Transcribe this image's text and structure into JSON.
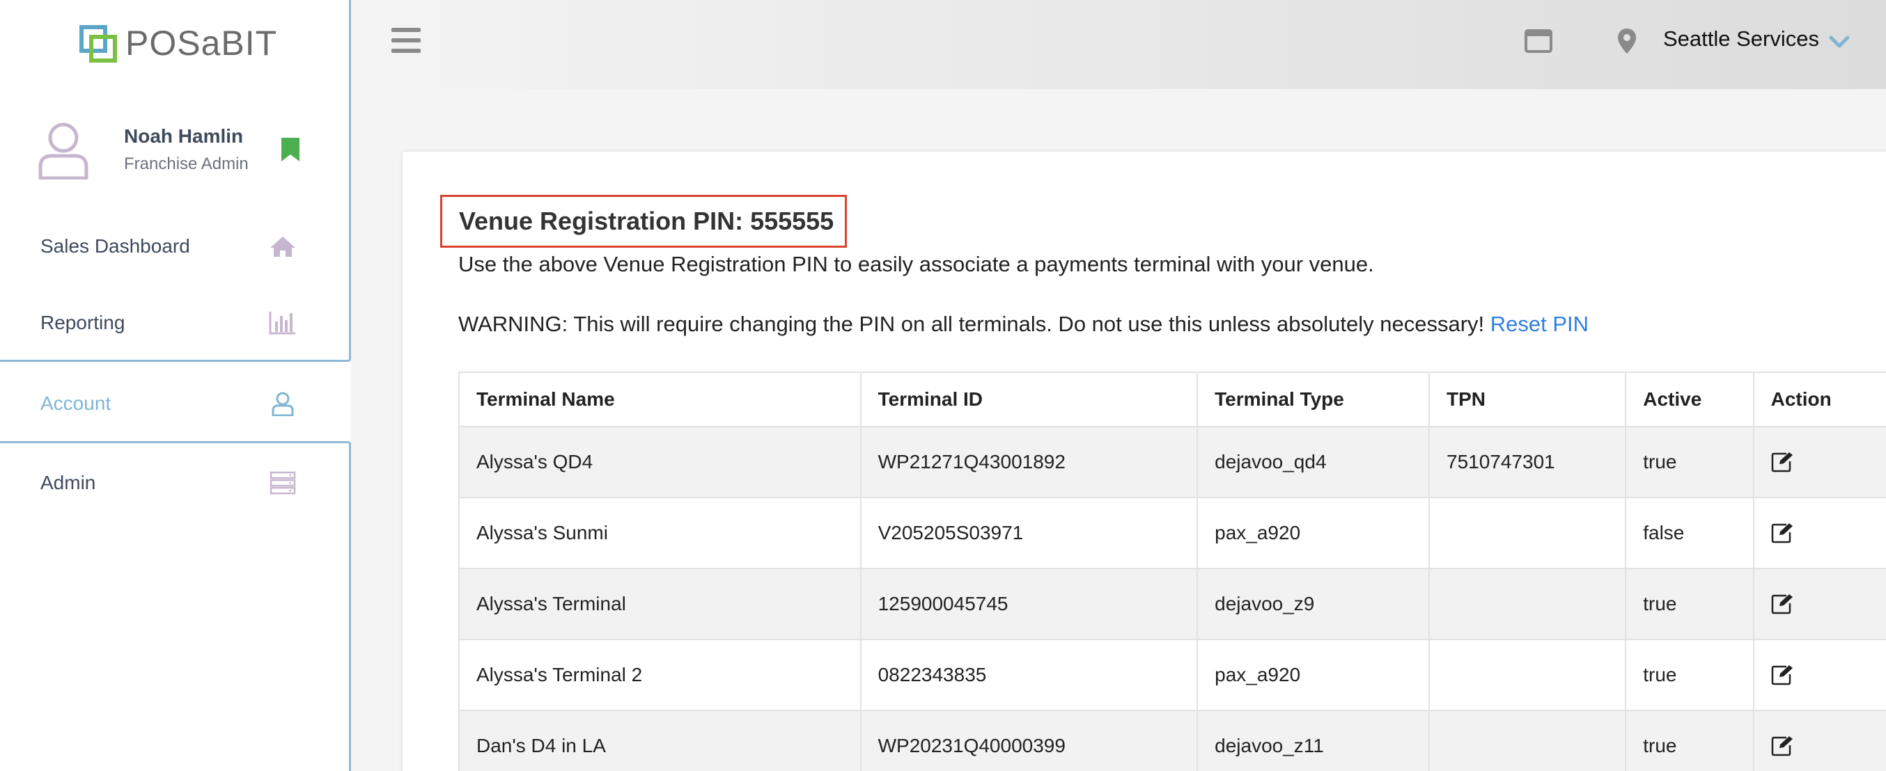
{
  "brand": {
    "logo_text": "POSaBIT"
  },
  "profile": {
    "name": "Noah Hamlin",
    "role": "Franchise Admin"
  },
  "nav": [
    {
      "label": "Sales Dashboard",
      "icon": "home-icon"
    },
    {
      "label": "Reporting",
      "icon": "bar-chart-icon"
    },
    {
      "label": "Account",
      "icon": "user-icon",
      "active": true
    },
    {
      "label": "Admin",
      "icon": "server-icon"
    }
  ],
  "header": {
    "venue": "Seattle Services"
  },
  "content": {
    "pin_title": "Venue Registration PIN: 555555",
    "info": "Use the above Venue Registration PIN to easily associate a payments terminal with your venue.",
    "warning": "WARNING: This will require changing the PIN on all terminals. Do not use this unless absolutely necessary! ",
    "reset_link": "Reset PIN"
  },
  "table": {
    "headers": [
      "Terminal Name",
      "Terminal ID",
      "Terminal Type",
      "TPN",
      "Active",
      "Action"
    ],
    "rows": [
      [
        "Alyssa's QD4",
        "WP21271Q43001892",
        "dejavoo_qd4",
        "7510747301",
        "true"
      ],
      [
        "Alyssa's Sunmi",
        "V205205S03971",
        "pax_a920",
        "",
        "false"
      ],
      [
        "Alyssa's Terminal",
        "125900045745",
        "dejavoo_z9",
        "",
        "true"
      ],
      [
        "Alyssa's Terminal 2",
        "0822343835",
        "pax_a920",
        "",
        "true"
      ],
      [
        "Dan's D4 in LA",
        "WP20231Q40000399",
        "dejavoo_z11",
        "",
        "true"
      ]
    ]
  },
  "colors": {
    "accent": "#7fb6d3",
    "warning_border": "#d9442e",
    "link": "#2f7fe0",
    "bookmark": "#4caf50"
  }
}
